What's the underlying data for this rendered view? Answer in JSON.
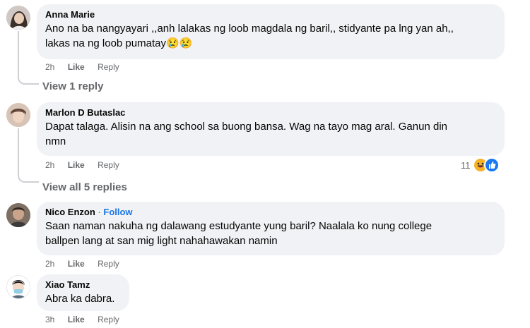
{
  "comments": [
    {
      "author": "Anna Marie",
      "text": "Ano na ba nangyayari ,,anh lalakas ng loob magdala ng baril,, stidyante pa lng yan ah,,\nlakas na ng loob pumatay😢😢",
      "time": "2h",
      "like": "Like",
      "reply": "Reply",
      "view_replies": "View 1 reply"
    },
    {
      "author": "Marlon D Butaslac",
      "text": "Dapat talaga. Alisin na ang school sa buong bansa. Wag na tayo mag aral. Ganun din\nnmn",
      "time": "2h",
      "like": "Like",
      "reply": "Reply",
      "reaction_count": "11",
      "reaction_icons": [
        "haha-icon",
        "like-icon"
      ],
      "view_replies": "View all 5 replies"
    },
    {
      "author": "Nico Enzon",
      "separator": "·",
      "follow": "Follow",
      "text": "Saan naman nakuha ng dalawang estudyante yung baril? Naalala ko nung college\nballpen lang at san mig light nahahawakan namin",
      "time": "2h",
      "like": "Like",
      "reply": "Reply"
    },
    {
      "author": "Xiao Tamz",
      "text": "Abra ka dabra.",
      "time": "3h",
      "like": "Like",
      "reply": "Reply"
    }
  ]
}
